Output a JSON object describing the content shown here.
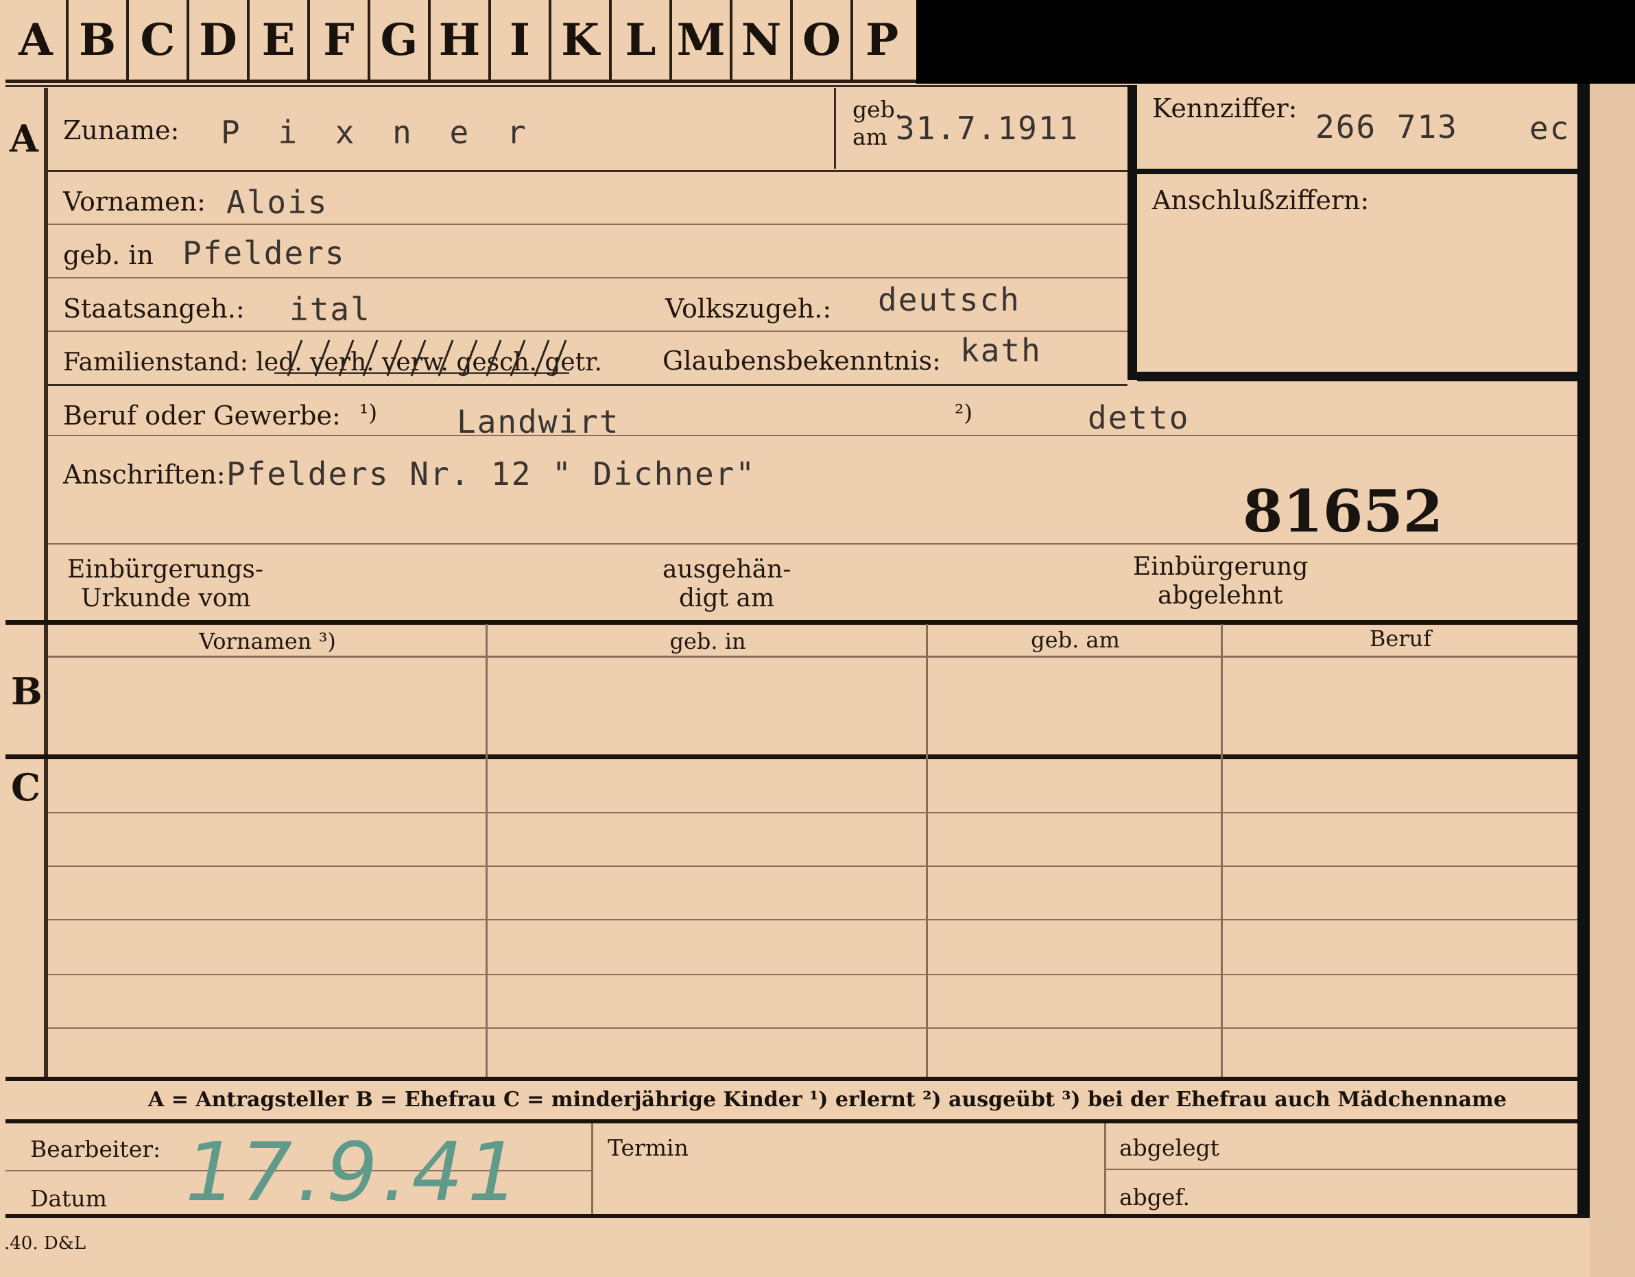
{
  "tabs": [
    "A",
    "B",
    "C",
    "D",
    "E",
    "F",
    "G",
    "H",
    "I",
    "K",
    "L",
    "M",
    "N",
    "O",
    "P"
  ],
  "sections": {
    "a": "A",
    "b": "B",
    "c": "C"
  },
  "fields": {
    "zuname_label": "Zuname:",
    "zuname_value": "P i x n e r",
    "geb_am_label_1": "geb.",
    "geb_am_label_2": "am",
    "geb_am_value": "31.7.1911",
    "kennziffer_label": "Kennziffer:",
    "kennziffer_value": "266 713",
    "kennziffer_suffix": "ec",
    "anschluss_label": "Anschlußziffern:",
    "vornamen_label": "Vornamen:",
    "vornamen_value": "Alois",
    "geb_in_label": "geb. in",
    "geb_in_value": "Pfelders",
    "staatsangeh_label": "Staatsangeh.:",
    "staatsangeh_value": "ital",
    "volkszugeh_label": "Volkszugeh.:",
    "volkszugeh_value": "deutsch",
    "familienstand_label": "Familienstand: led. verh. verw. gesch. getr.",
    "glauben_label": "Glaubensbekenntnis:",
    "glauben_value": "kath",
    "beruf_label": "Beruf oder Gewerbe:",
    "beruf_mark_1": "¹)",
    "beruf_value_1": "Landwirt",
    "beruf_mark_2": "²)",
    "beruf_value_2": "detto",
    "anschriften_label": "Anschriften:",
    "anschriften_value": "Pfelders Nr. 12 \" Dichner\"",
    "stamp_number": "81652",
    "einb_urkunde_1": "Einbürgerungs-",
    "einb_urkunde_2": "Urkunde vom",
    "ausgehaendigt_1": "ausgehän-",
    "ausgehaendigt_2": "digt am",
    "einb_abgelehnt_1": "Einbürgerung",
    "einb_abgelehnt_2": "abgelehnt"
  },
  "table_headers": [
    "Vornamen ³)",
    "geb. in",
    "geb. am",
    "Beruf"
  ],
  "legend": "A = Antragsteller   B = Ehefrau   C = minderjährige Kinder   ¹) erlernt   ²) ausgeübt   ³) bei der Ehefrau auch Mädchenname",
  "footer": {
    "bearbeiter_label": "Bearbeiter:",
    "datum_label": "Datum",
    "datum_handwritten": "17.9.41",
    "termin_label": "Termin",
    "abgelegt_label": "abgelegt",
    "abgef_label": "abgef.",
    "print_code": ".40. D&L"
  },
  "colors": {
    "card": "#eecfb0",
    "ink": "#1e150f",
    "typewriter": "#3a3430",
    "handwriting": "#5f9a8a",
    "background": "#000000"
  }
}
